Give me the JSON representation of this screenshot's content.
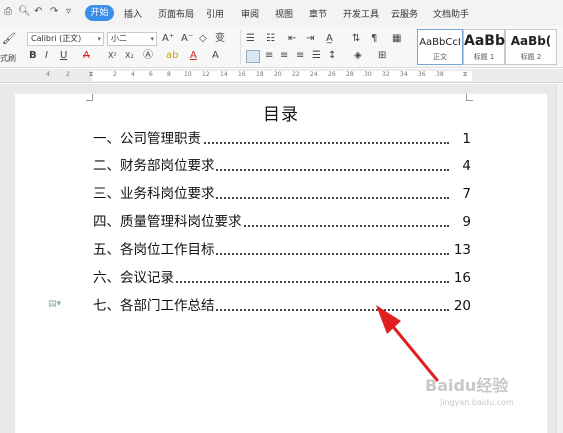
{
  "menu": {
    "tabs": [
      "开始",
      "插入",
      "页面布局",
      "引用",
      "审阅",
      "视图",
      "章节",
      "开发工具",
      "云服务",
      "文档助手"
    ]
  },
  "ribbon": {
    "font_name": "Calibri (正文)",
    "font_size": "小二",
    "style_gallery": [
      {
        "sample": "AaBbCcI",
        "caption": "正文"
      },
      {
        "sample": "AaBb",
        "caption": "标题 1"
      },
      {
        "sample": "AaBb(",
        "caption": "标题 2"
      }
    ],
    "format_painter_fragment": "式刷"
  },
  "ruler": {
    "numbers": [
      "4",
      "2",
      "2",
      "4",
      "6",
      "8",
      "10",
      "12",
      "14",
      "16",
      "18",
      "20",
      "22",
      "24",
      "26",
      "28",
      "30",
      "32",
      "34",
      "36",
      "38"
    ]
  },
  "document": {
    "title": "目录",
    "toc": [
      {
        "label": "一、公司管理职责",
        "page": "1"
      },
      {
        "label": "二、财务部岗位要求",
        "page": "4"
      },
      {
        "label": "三、业务科岗位要求",
        "page": "7"
      },
      {
        "label": "四、质量管理科岗位要求",
        "page": "9"
      },
      {
        "label": "五、各岗位工作目标",
        "page": "13"
      },
      {
        "label": "六、会议记录",
        "page": "16"
      },
      {
        "label": "七、各部门工作总结",
        "page": "20"
      }
    ]
  },
  "watermark": {
    "text": "Baidu经验",
    "url": "jingyan.baidu.com"
  },
  "colors": {
    "accent": "#3b8ee8",
    "arrow": "#e02020"
  }
}
